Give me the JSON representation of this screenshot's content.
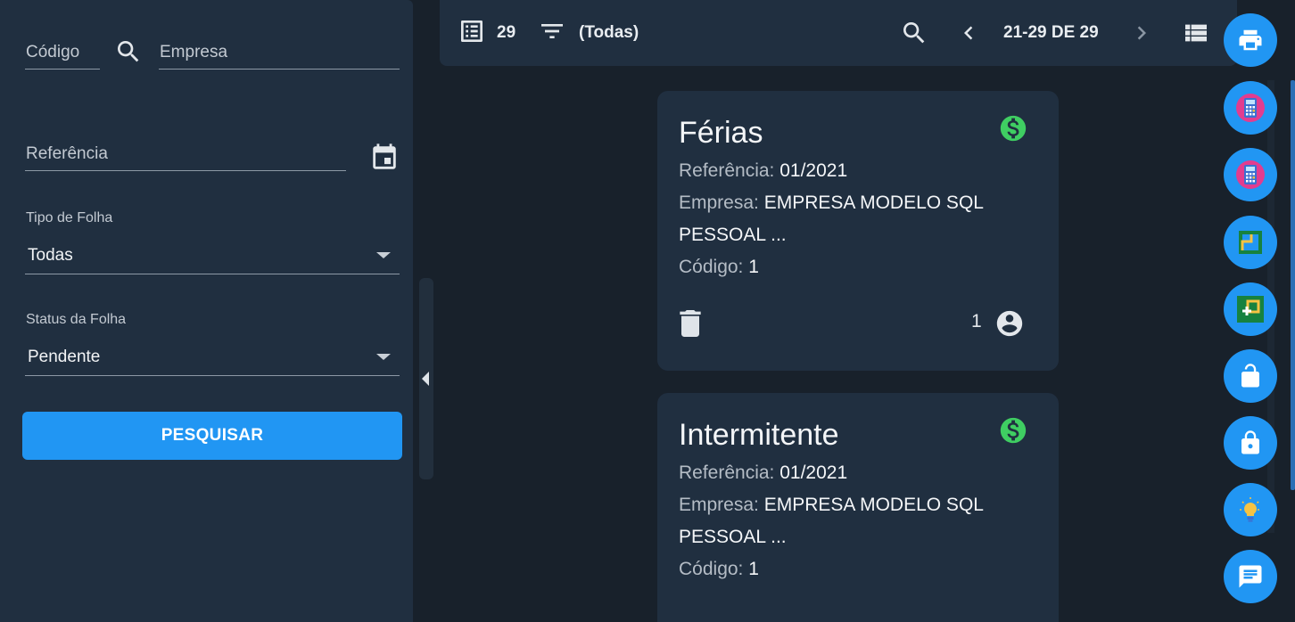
{
  "filters": {
    "codigo_placeholder": "Código",
    "empresa_placeholder": "Empresa",
    "referencia_placeholder": "Referência",
    "tipo_label": "Tipo de Folha",
    "tipo_value": "Todas",
    "status_label": "Status da Folha",
    "status_value": "Pendente",
    "search_button": "PESQUISAR"
  },
  "toolbar": {
    "count": "29",
    "filter_label": "(Todas)",
    "pagination": "21-29 DE 29"
  },
  "cards": [
    {
      "title": "Férias",
      "ref_key": "Referência:",
      "ref_val": "01/2021",
      "emp_key": "Empresa:",
      "emp_val1": "EMPRESA MODELO SQL",
      "emp_val2": "PESSOAL ...",
      "cod_key": "Código:",
      "cod_val": "1",
      "users": "1"
    },
    {
      "title": "Intermitente",
      "ref_key": "Referência:",
      "ref_val": "01/2021",
      "emp_key": "Empresa:",
      "emp_val1": "EMPRESA MODELO SQL",
      "emp_val2": "PESSOAL ...",
      "cod_key": "Código:",
      "cod_val": "1",
      "users": ""
    }
  ],
  "rail_icons": [
    "print-icon",
    "calculator-icon",
    "calculator-icon",
    "corner-box-icon",
    "add-box-icon",
    "unlock-icon",
    "lock-icon",
    "lightbulb-icon",
    "chat-icon"
  ],
  "colors": {
    "accent": "#2196f3",
    "money": "#3fce62",
    "panel": "#202f40",
    "background": "#18212b"
  }
}
